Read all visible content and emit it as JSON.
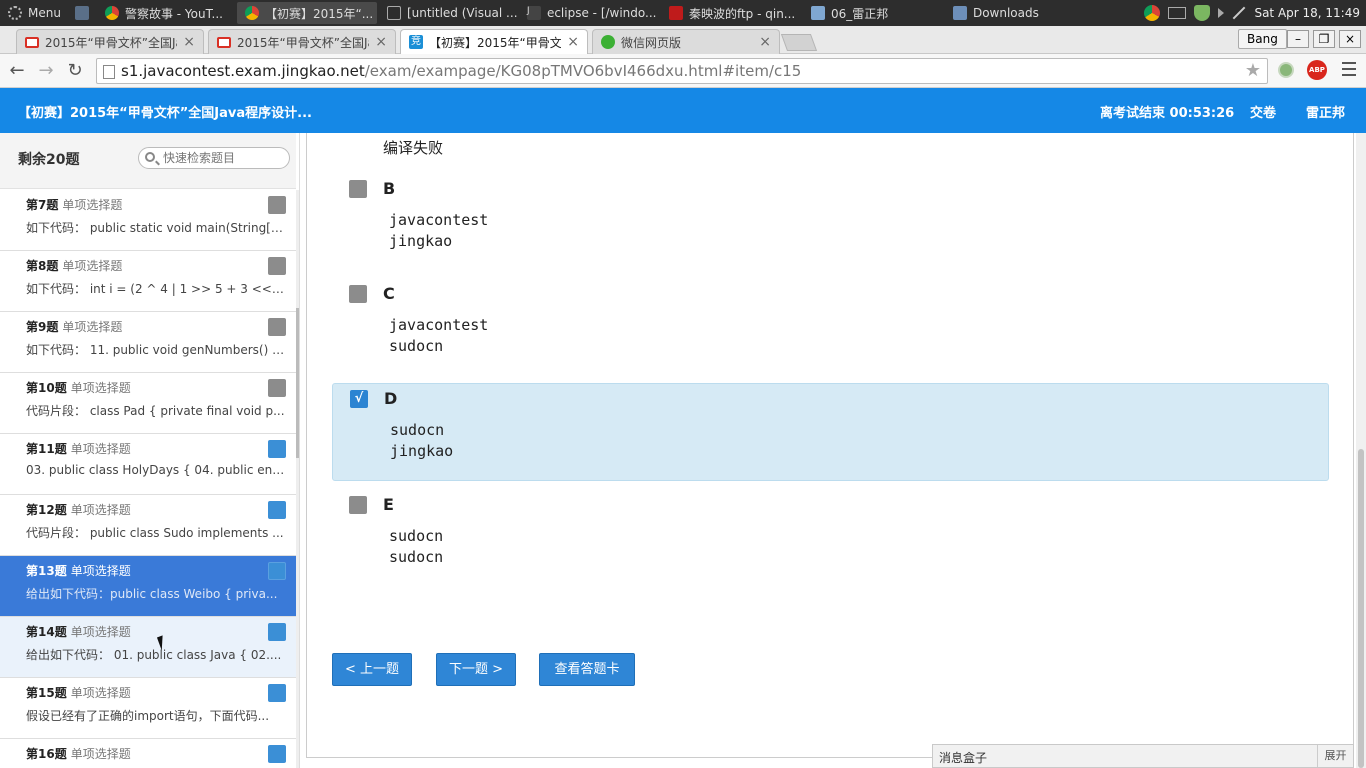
{
  "os": {
    "menu_label": "Menu",
    "tasks": [
      {
        "label": "警察故事 - YouT...",
        "active": false
      },
      {
        "label": "【初赛】2015年“...",
        "active": true
      },
      {
        "label": "[untitled (Visual ...",
        "active": false
      },
      {
        "label": "eclipse - [/windo...",
        "active": false
      },
      {
        "label": "秦映波的ftp - qin...",
        "active": false
      },
      {
        "label": "06_雷正邦",
        "active": false
      },
      {
        "label": "Downloads",
        "active": false
      }
    ],
    "clock": "Sat Apr 18, 11:49"
  },
  "browser": {
    "tabs": [
      {
        "label": "2015年“甲骨文杯”全国Jav",
        "active": false
      },
      {
        "label": "2015年“甲骨文杯”全国Jav",
        "active": false
      },
      {
        "label": "【初赛】2015年“甲骨文杯",
        "active": true
      },
      {
        "label": "微信网页版",
        "active": false
      }
    ],
    "profile": "Bang",
    "url_host": "s1.javacontest.exam.jingkao.net",
    "url_path": "/exam/exampage/KG08pTMVO6bvI466dxu.html#item/c15"
  },
  "header": {
    "title": "【初赛】2015年“甲骨文杯”全国Java程序设计...",
    "countdown": "离考试结束 00:53:26",
    "submit": "交卷",
    "user": "雷正邦"
  },
  "sidebar": {
    "remaining": "剩余20题",
    "search_placeholder": "快速检索题目",
    "questions": [
      {
        "no": "第7题",
        "type": "单项选择题",
        "preview": "如下代码： public static void main(String[] ...",
        "answered": false
      },
      {
        "no": "第8题",
        "type": "单项选择题",
        "preview": "如下代码： int i = (2 ^ 4 | 1 >> 5 + 3 << 3 ...",
        "answered": false
      },
      {
        "no": "第9题",
        "type": "单项选择题",
        "preview": "如下代码： 11. public void genNumbers() {...",
        "answered": false
      },
      {
        "no": "第10题",
        "type": "单项选择题",
        "preview": "代码片段： class Pad { private final void p...",
        "answered": false
      },
      {
        "no": "第11题",
        "type": "单项选择题",
        "preview": "03. public class HolyDays { 04. public enu...",
        "answered": true
      },
      {
        "no": "第12题",
        "type": "单项选择题",
        "preview": "代码片段： public class Sudo implements ...",
        "answered": true
      },
      {
        "no": "第13题",
        "type": "单项选择题",
        "preview": "给出如下代码：public class Weibo {   priva...",
        "answered": true
      },
      {
        "no": "第14题",
        "type": "单项选择题",
        "preview": "给出如下代码： 01. public class Java { 02....",
        "answered": true
      },
      {
        "no": "第15题",
        "type": "单项选择题",
        "preview": "假设已经有了正确的import语句，下面代码...",
        "answered": true
      },
      {
        "no": "第16题",
        "type": "单项选择题",
        "preview": "",
        "answered": true
      }
    ]
  },
  "main": {
    "prev_answer_text": "编译失败",
    "options": [
      {
        "letter": "B",
        "line1": "javacontest",
        "line2": "jingkao",
        "checked": false,
        "check_glyph": ""
      },
      {
        "letter": "C",
        "line1": "javacontest",
        "line2": "sudocn",
        "checked": false,
        "check_glyph": ""
      },
      {
        "letter": "D",
        "line1": "sudocn",
        "line2": "jingkao",
        "checked": true,
        "check_glyph": "√"
      },
      {
        "letter": "E",
        "line1": "sudocn",
        "line2": "sudocn",
        "checked": false,
        "check_glyph": ""
      }
    ],
    "prev_button": "< 上一题",
    "next_button": "下一题 >",
    "answer_card_button": "查看答题卡"
  },
  "message_box": {
    "title": "消息盒子",
    "expand": "展开"
  },
  "colors": {
    "header_bg": "#1588e6",
    "current_item_bg": "#3a7ad8",
    "selected_option_bg": "#d6eaf5",
    "button_bg": "#2f86d6"
  }
}
